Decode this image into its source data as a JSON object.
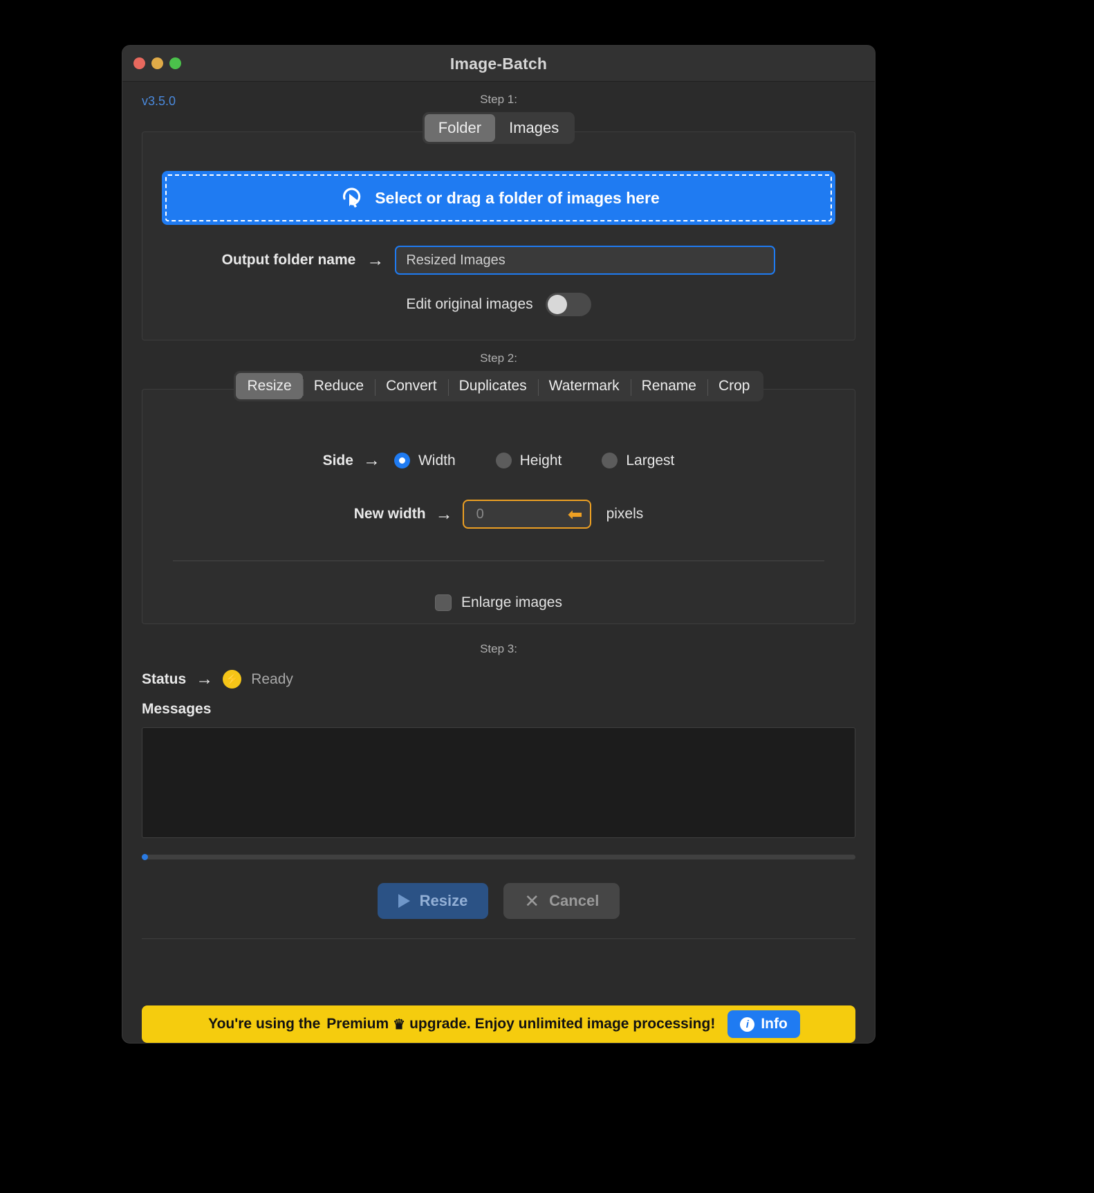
{
  "window": {
    "title": "Image-Batch",
    "version": "v3.5.0",
    "traffic_lights": [
      "close-button",
      "minimize-button",
      "zoom-button"
    ]
  },
  "step1": {
    "label": "Step 1:",
    "tabs": [
      {
        "label": "Folder",
        "active": true
      },
      {
        "label": "Images",
        "active": false
      }
    ],
    "dropzone": {
      "text": "Select or drag a folder of images here",
      "icon": "cursor-click-icon",
      "bg_color": "#1f7bf2"
    },
    "output_folder": {
      "label": "Output folder name",
      "arrow": "→",
      "value": "Resized Images",
      "placeholder": "Resized Images",
      "border_color": "#1f7bf2"
    },
    "edit_original": {
      "label": "Edit original images",
      "state": "off"
    }
  },
  "step2": {
    "label": "Step 2:",
    "tabs": [
      {
        "label": "Resize",
        "active": true
      },
      {
        "label": "Reduce",
        "active": false
      },
      {
        "label": "Convert",
        "active": false
      },
      {
        "label": "Duplicates",
        "active": false
      },
      {
        "label": "Watermark",
        "active": false
      },
      {
        "label": "Rename",
        "active": false
      },
      {
        "label": "Crop",
        "active": false
      }
    ],
    "side": {
      "label": "Side",
      "arrow": "→",
      "options": [
        {
          "label": "Width",
          "selected": true
        },
        {
          "label": "Height",
          "selected": false
        },
        {
          "label": "Largest",
          "selected": false
        }
      ]
    },
    "new_width": {
      "label": "New width",
      "arrow": "→",
      "value": "",
      "placeholder": "0",
      "unit": "pixels",
      "border_color": "#eda023",
      "hint_icon": "arrow-left-icon"
    },
    "enlarge": {
      "label": "Enlarge images",
      "checked": false
    }
  },
  "step3": {
    "label": "Step 3:",
    "status": {
      "label": "Status",
      "arrow": "→",
      "icon": "lightning-bolt-icon",
      "value": "Ready",
      "icon_color": "#f5c518"
    },
    "messages": {
      "label": "Messages",
      "content": ""
    },
    "progress": {
      "percent": 0
    },
    "buttons": {
      "primary": {
        "label": "Resize",
        "icon": "play-icon",
        "color": "#2b5285"
      },
      "secondary": {
        "label": "Cancel",
        "icon": "close-x-icon",
        "color": "#464646"
      }
    }
  },
  "banner": {
    "prefix": "You're using the",
    "tier": "Premium",
    "crown": "♛",
    "suffix": "upgrade. Enjoy unlimited image processing!",
    "info_label": "Info",
    "bg_color": "#f5cc0e",
    "info_color": "#1f7bf2"
  }
}
